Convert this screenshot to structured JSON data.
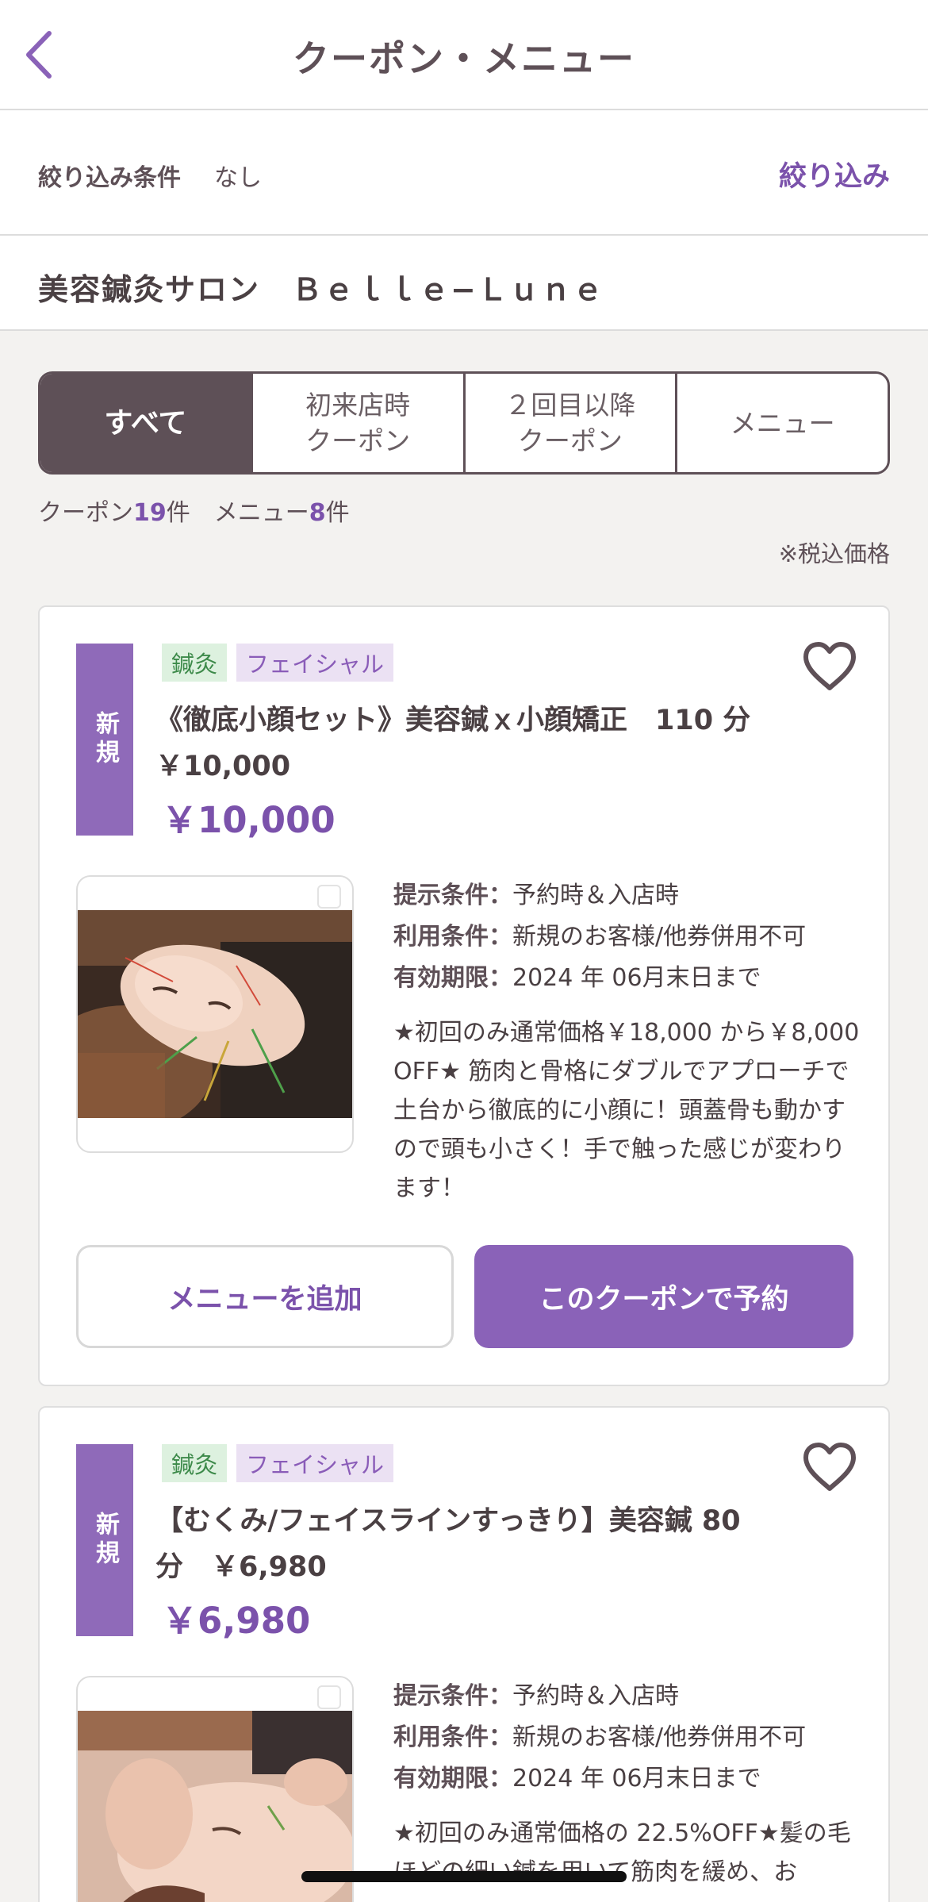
{
  "header": {
    "title": "クーポン・メニュー",
    "back_icon": "chevron-left-icon"
  },
  "filter": {
    "label": "絞り込み条件",
    "value": "なし",
    "button": "絞り込み"
  },
  "salon": {
    "name": "美容鍼灸サロン　Ｂｅｌｌｅ−Ｌｕｎｅ"
  },
  "tabs": [
    {
      "label": "すべて",
      "active": true
    },
    {
      "label": "初来店時\nクーポン",
      "active": false
    },
    {
      "label": "２回目以降\nクーポン",
      "active": false
    },
    {
      "label": "メニュー",
      "active": false
    }
  ],
  "counts": {
    "coupon_label": "クーポン",
    "coupon_count": "19",
    "menu_label": "メニュー",
    "menu_count": "8",
    "unit": "件"
  },
  "tax_note": "※税込価格",
  "colors": {
    "accent": "#7b52ab",
    "badge": "#8f6ab9",
    "tab_active": "#5e5057"
  },
  "coupons": [
    {
      "badge": "新規",
      "tags": [
        "鍼灸",
        "フェイシャル"
      ],
      "title": "《徹底小顔セット》美容鍼ｘ小顔矯正　110 分　￥10,000",
      "price": "￥10,000",
      "conditions": [
        {
          "key": "提示条件：",
          "value": "予約時＆入店時"
        },
        {
          "key": "利用条件：",
          "value": "新規のお客様/他券併用不可"
        },
        {
          "key": "有効期限：",
          "value": "2024 年 06月末日まで"
        }
      ],
      "description": "★初回のみ通常価格￥18,000 から￥8,000OFF★ 筋肉と骨格にダブルでアプローチで土台から徹底的に小顔に！頭蓋骨も動かすので頭も小さく！手で触った感じが変わります！",
      "add_button": "メニューを追加",
      "reserve_button": "このクーポンで予約"
    },
    {
      "badge": "新規",
      "tags": [
        "鍼灸",
        "フェイシャル"
      ],
      "title": "【むくみ/フェイスラインすっきり】美容鍼 80 分　￥6,980",
      "price": "￥6,980",
      "conditions": [
        {
          "key": "提示条件：",
          "value": "予約時＆入店時"
        },
        {
          "key": "利用条件：",
          "value": "新規のお客様/他券併用不可"
        },
        {
          "key": "有効期限：",
          "value": "2024 年 06月末日まで"
        }
      ],
      "description": "★初回のみ通常価格の 22.5%OFF★髪の毛ほどの細い鍼を用いて筋肉を緩め、お"
    }
  ]
}
